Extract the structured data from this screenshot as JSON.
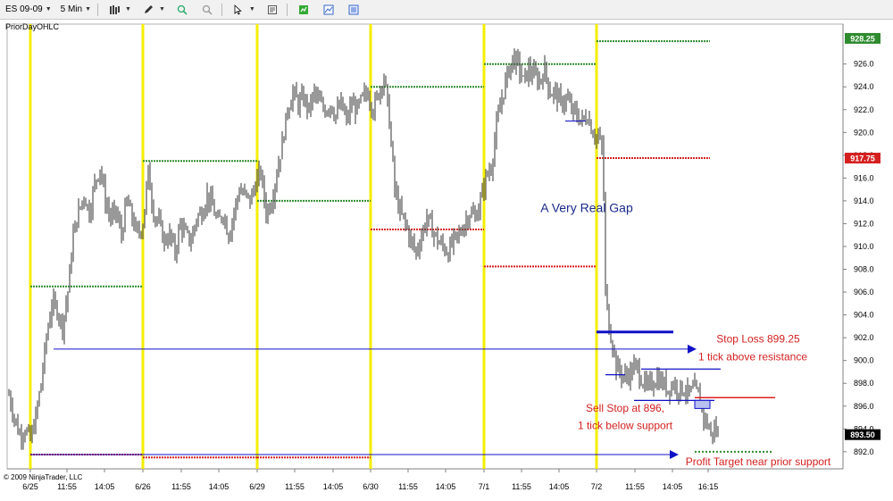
{
  "toolbar": {
    "instrument": "ES 09-09",
    "period": "5 Min",
    "icons": [
      "bar-chart-style-icon",
      "drawing-pencil-icon",
      "zoom-in-icon",
      "zoom-out-icon",
      "pointer-icon",
      "properties-icon",
      "strategies-icon",
      "chart-trader-icon",
      "data-box-icon"
    ]
  },
  "indicator_label": "PriorDayOHLC",
  "copyright": "© 2009 NinjaTrader, LLC",
  "chart_data": {
    "type": "candlestick",
    "title": "",
    "ylim": [
      890.5,
      929.5
    ],
    "y_ticks": [
      892.0,
      894.0,
      896.0,
      898.0,
      900.0,
      902.0,
      904.0,
      906.0,
      908.0,
      910.0,
      912.0,
      914.0,
      916.0,
      918.0,
      920.0,
      922.0,
      924.0,
      926.0
    ],
    "x_ticks": [
      "6/25",
      "11:55",
      "14:05",
      "6/26",
      "11:55",
      "14:05",
      "6/29",
      "11:55",
      "14:05",
      "6/30",
      "11:55",
      "14:05",
      "7/1",
      "11:55",
      "14:05",
      "7/2",
      "11:55",
      "14:05",
      "16:15"
    ],
    "price_markers": [
      {
        "value": "928.25",
        "color": "#2e8b2e"
      },
      {
        "value": "917.75",
        "color": "#d42020"
      },
      {
        "value": "893.50",
        "color": "#000000"
      }
    ],
    "session_starts": [
      "6/25",
      "6/26",
      "6/29",
      "6/30",
      "7/1",
      "7/2"
    ],
    "prior_day_levels": [
      {
        "session": "6/25",
        "high": 906.5,
        "low": 891.75
      },
      {
        "session": "6/26",
        "high": 917.5,
        "low": 891.5
      },
      {
        "session": "6/29",
        "high": 914.0,
        "low": 891.5
      },
      {
        "session": "6/30",
        "high": 924.0,
        "low": 911.5
      },
      {
        "session": "7/1",
        "high": 926.0,
        "low": 908.25
      },
      {
        "session": "7/2",
        "high": 928.0,
        "low": 917.75
      }
    ],
    "price_path": [
      [
        0,
        897.0
      ],
      [
        6,
        895.0
      ],
      [
        12,
        893.5
      ],
      [
        18,
        894.0
      ],
      [
        24,
        893.0
      ],
      [
        30,
        895.0
      ],
      [
        36,
        898.0
      ],
      [
        42,
        902.0
      ],
      [
        48,
        905.0
      ],
      [
        54,
        904.5
      ],
      [
        60,
        903.0
      ],
      [
        66,
        906.0
      ],
      [
        72,
        911.0
      ],
      [
        78,
        913.0
      ],
      [
        84,
        914.5
      ],
      [
        90,
        913.0
      ],
      [
        96,
        915.5
      ],
      [
        102,
        917.0
      ],
      [
        108,
        914.0
      ],
      [
        114,
        912.5
      ],
      [
        120,
        913.0
      ],
      [
        126,
        911.0
      ],
      [
        132,
        914.0
      ],
      [
        138,
        912.5
      ],
      [
        144,
        911.0
      ],
      [
        150,
        912.0
      ],
      [
        156,
        916.5
      ],
      [
        162,
        913.0
      ],
      [
        168,
        912.0
      ],
      [
        174,
        910.5
      ],
      [
        180,
        911.0
      ],
      [
        186,
        909.5
      ],
      [
        192,
        912.0
      ],
      [
        198,
        911.0
      ],
      [
        204,
        910.5
      ],
      [
        210,
        912.5
      ],
      [
        216,
        913.0
      ],
      [
        222,
        914.5
      ],
      [
        228,
        913.5
      ],
      [
        234,
        912.0
      ],
      [
        240,
        913.0
      ],
      [
        246,
        911.0
      ],
      [
        252,
        913.0
      ],
      [
        258,
        915.0
      ],
      [
        264,
        914.5
      ],
      [
        270,
        914.0
      ],
      [
        276,
        915.5
      ],
      [
        282,
        916.5
      ],
      [
        288,
        913.0
      ],
      [
        294,
        914.0
      ],
      [
        300,
        916.5
      ],
      [
        306,
        919.0
      ],
      [
        312,
        922.0
      ],
      [
        318,
        923.5
      ],
      [
        324,
        922.5
      ],
      [
        330,
        923.0
      ],
      [
        336,
        922.0
      ],
      [
        342,
        923.5
      ],
      [
        348,
        922.5
      ],
      [
        354,
        922.0
      ],
      [
        360,
        922.5
      ],
      [
        366,
        921.5
      ],
      [
        372,
        922.5
      ],
      [
        378,
        921.0
      ],
      [
        384,
        922.5
      ],
      [
        390,
        922.0
      ],
      [
        396,
        923.0
      ],
      [
        402,
        923.5
      ],
      [
        408,
        922.0
      ],
      [
        414,
        923.5
      ],
      [
        420,
        925.0
      ],
      [
        426,
        921.0
      ],
      [
        432,
        915.0
      ],
      [
        438,
        913.0
      ],
      [
        444,
        912.0
      ],
      [
        450,
        910.5
      ],
      [
        456,
        909.5
      ],
      [
        462,
        911.0
      ],
      [
        468,
        912.5
      ],
      [
        474,
        911.5
      ],
      [
        480,
        910.5
      ],
      [
        486,
        910.0
      ],
      [
        492,
        909.5
      ],
      [
        498,
        910.5
      ],
      [
        504,
        911.0
      ],
      [
        510,
        912.0
      ],
      [
        516,
        913.0
      ],
      [
        522,
        912.5
      ],
      [
        528,
        914.0
      ],
      [
        534,
        916.0
      ],
      [
        540,
        917.0
      ],
      [
        546,
        920.5
      ],
      [
        552,
        923.0
      ],
      [
        558,
        925.0
      ],
      [
        564,
        926.5
      ],
      [
        570,
        926.0
      ],
      [
        576,
        924.5
      ],
      [
        582,
        925.5
      ],
      [
        588,
        925.0
      ],
      [
        594,
        924.5
      ],
      [
        600,
        925.5
      ],
      [
        606,
        923.5
      ],
      [
        612,
        923.5
      ],
      [
        618,
        922.5
      ],
      [
        624,
        923.0
      ],
      [
        630,
        922.0
      ],
      [
        636,
        921.5
      ],
      [
        642,
        921.0
      ],
      [
        648,
        921.5
      ],
      [
        654,
        920.0
      ],
      [
        660,
        919.5
      ],
      [
        665,
        918.5
      ],
      [
        668,
        906.0
      ],
      [
        672,
        903.0
      ],
      [
        676,
        901.5
      ],
      [
        680,
        899.5
      ],
      [
        684,
        899.0
      ],
      [
        690,
        898.5
      ],
      [
        696,
        899.0
      ],
      [
        702,
        899.5
      ],
      [
        708,
        898.5
      ],
      [
        714,
        897.5
      ],
      [
        720,
        898.0
      ],
      [
        726,
        898.5
      ],
      [
        732,
        898.0
      ],
      [
        738,
        897.5
      ],
      [
        744,
        898.0
      ],
      [
        750,
        897.5
      ],
      [
        756,
        897.5
      ],
      [
        762,
        897.0
      ],
      [
        768,
        897.5
      ],
      [
        774,
        896.5
      ],
      [
        778,
        895.0
      ],
      [
        782,
        894.5
      ],
      [
        786,
        893.5
      ],
      [
        790,
        894.0
      ],
      [
        795,
        893.5
      ]
    ],
    "annotations": [
      {
        "text": "A Very Real Gap",
        "color": "#1a2a8a"
      },
      {
        "text": "Stop Loss 899.25",
        "color": "#d42020"
      },
      {
        "text": "1 tick above resistance",
        "color": "#d42020"
      },
      {
        "text": "Sell Stop at 896,",
        "color": "#d42020"
      },
      {
        "text": "1 tick below support",
        "color": "#d42020"
      },
      {
        "text": "Profit Target near prior support",
        "color": "#d42020"
      }
    ],
    "drawn_lines": [
      {
        "kind": "arrow",
        "name": "resistance-arrow",
        "price": 901.0
      },
      {
        "kind": "arrow",
        "name": "support-arrow",
        "price": 891.75
      },
      {
        "kind": "line",
        "name": "resistance-level-thick",
        "price": 902.5
      },
      {
        "kind": "line",
        "name": "stop-loss-line",
        "price": 899.25
      },
      {
        "kind": "line",
        "name": "entry-line",
        "price": 896.5
      },
      {
        "kind": "line",
        "name": "stop-red-line",
        "price": 896.75
      },
      {
        "kind": "line",
        "name": "profit-target-line",
        "price": 892.0
      }
    ]
  },
  "colors": {
    "session_bar": "#f5ee00",
    "prior_high": "#2e8b2e",
    "prior_low": "#d42020",
    "candles": "#555555",
    "annotation_red": "#d42020",
    "annotation_blue": "#1a2a8a",
    "drawing_blue": "#1010c8"
  }
}
